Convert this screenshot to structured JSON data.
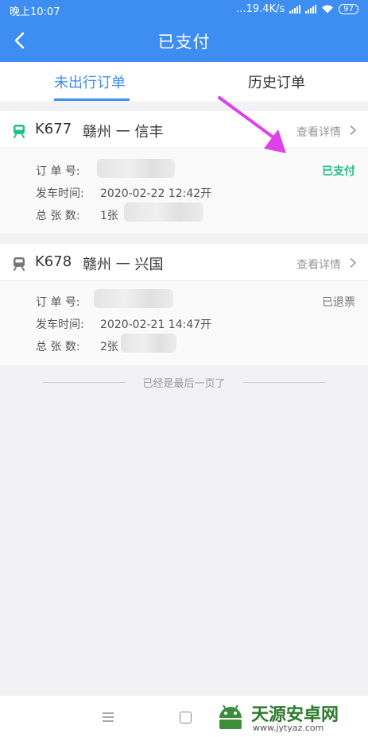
{
  "status_bar": {
    "time": "晚上10:07",
    "speed": "...19.4K/s",
    "battery": "97"
  },
  "nav": {
    "title": "已支付"
  },
  "tabs": [
    {
      "label": "未出行订单",
      "active": true
    },
    {
      "label": "历史订单",
      "active": false
    }
  ],
  "orders": [
    {
      "train_no": "K677",
      "route": "赣州 一 信丰",
      "detail_label": "查看详情",
      "status": "已支付",
      "order_no_label": "订 单 号:",
      "depart_label": "发车时间:",
      "depart_time": "2020-02-22  12:42开",
      "count_label": "总 张 数:",
      "count": "1张"
    },
    {
      "train_no": "K678",
      "route": "赣州 一 兴国",
      "detail_label": "查看详情",
      "status": "已退票",
      "order_no_label": "订 单 号:",
      "depart_label": "发车时间:",
      "depart_time": "2020-02-21  14:47开",
      "count_label": "总 张 数:",
      "count": "2张"
    }
  ],
  "end_text": "已经是最后一页了",
  "watermark": {
    "name": "天源安卓网",
    "url": "www.jytyaz.com"
  },
  "colors": {
    "primary": "#3d8df2",
    "paid": "#1ebf8a",
    "annotation_arrow": "#e040e8"
  }
}
